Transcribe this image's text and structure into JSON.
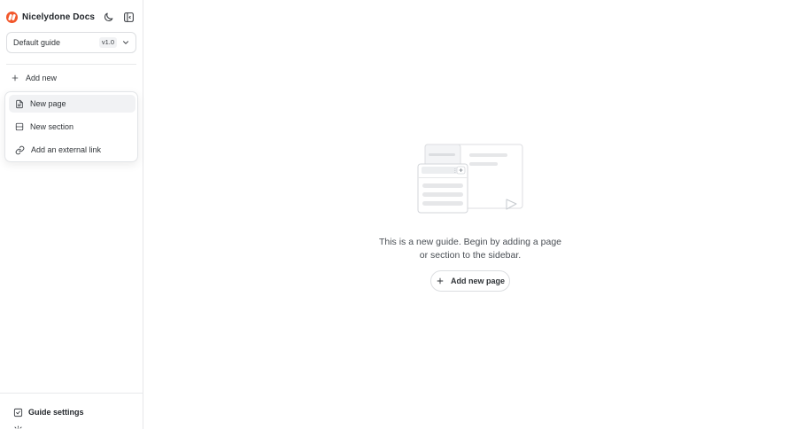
{
  "app": {
    "name": "Nicelydone Docs",
    "brand_color": "#f2572b"
  },
  "header_icons": {
    "theme_toggle": "moon-icon",
    "sidebar_toggle": "sidebar-collapse-icon"
  },
  "guide_selector": {
    "value": "Default guide",
    "version": "v1.0"
  },
  "sidebar": {
    "add_new_label": "Add new",
    "menu": [
      {
        "label": "New page",
        "icon": "file-icon"
      },
      {
        "label": "New section",
        "icon": "section-icon"
      },
      {
        "label": "Add an external link",
        "icon": "link-icon"
      }
    ],
    "bottom": [
      {
        "label": "Guide settings",
        "icon": "settings-icon"
      },
      {
        "label": "",
        "icon": "gear-icon"
      }
    ]
  },
  "empty_state": {
    "line1": "This is a new guide. Begin by adding a page",
    "line2": "or section to the sidebar.",
    "button_label": "Add new page"
  }
}
